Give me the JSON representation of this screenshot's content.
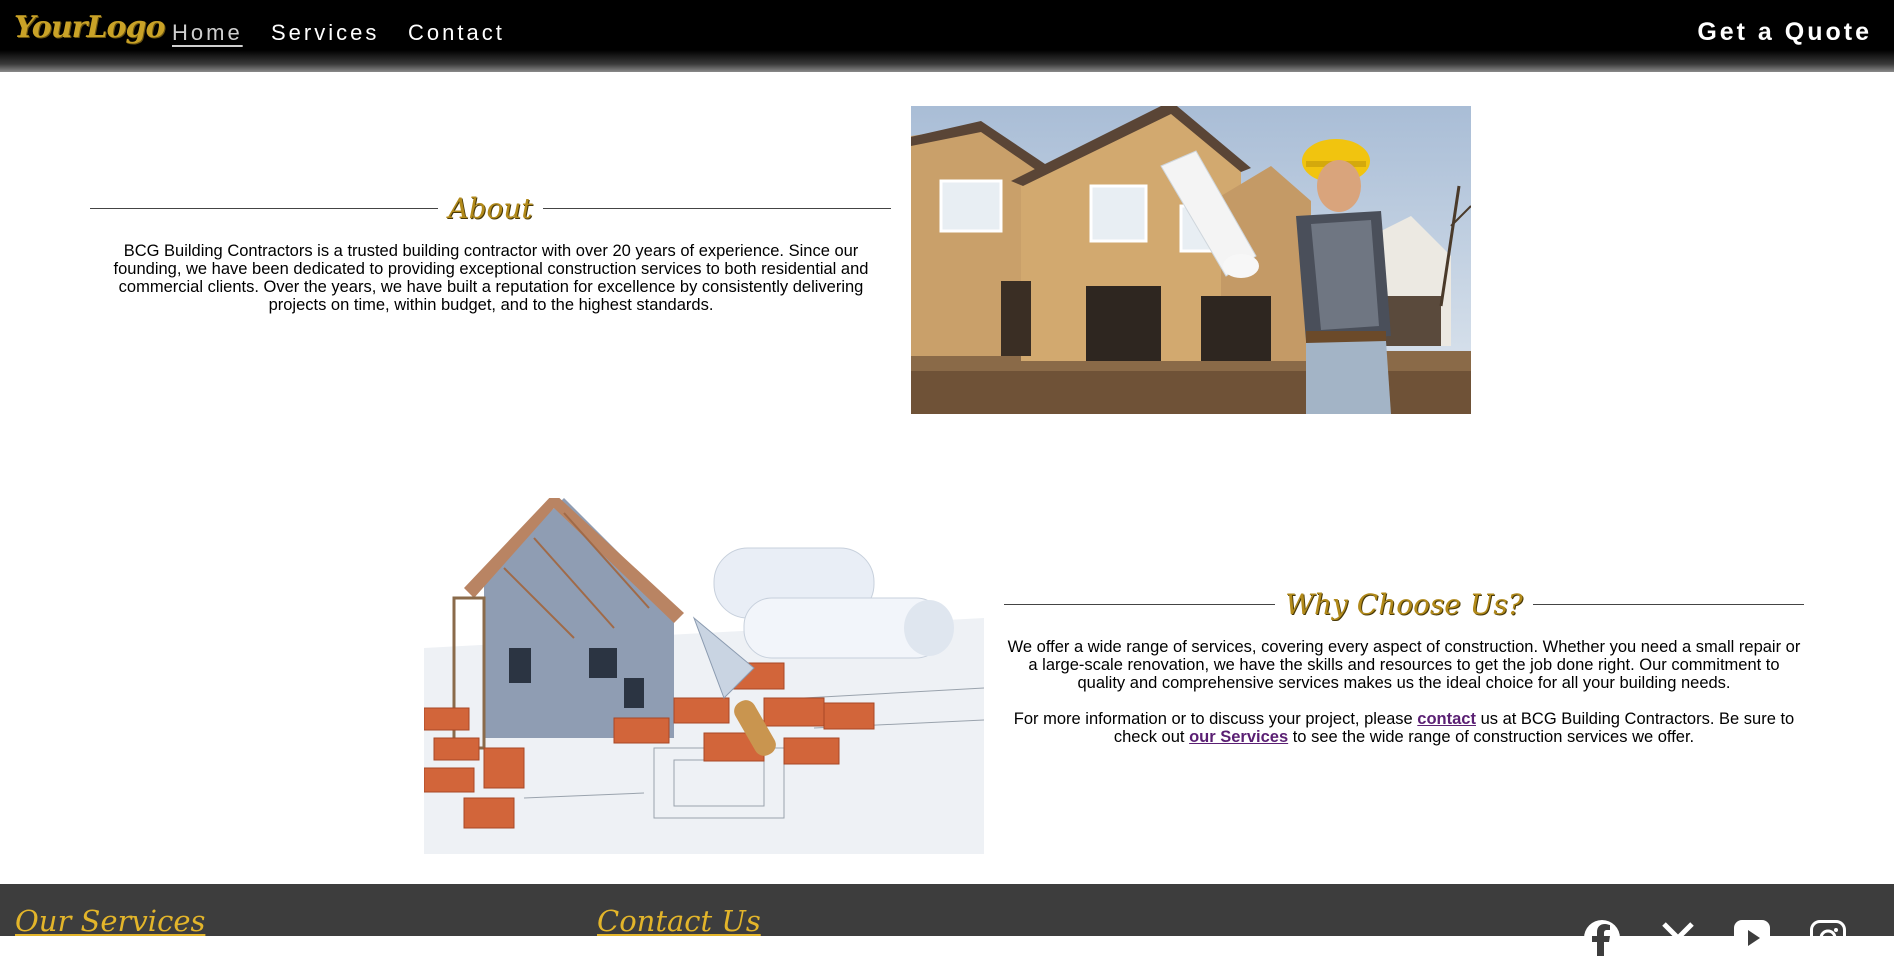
{
  "nav": {
    "logo": "YourLogo",
    "links": [
      "Home",
      "Services",
      "Contact"
    ],
    "quote": "Get a Quote"
  },
  "about": {
    "title": "About",
    "text": "BCG Building Contractors is a trusted building contractor with over 20 years of experience. Since our founding, we have been dedicated to providing exceptional construction services to both residential and commercial clients. Over the years, we have built a reputation for excellence by consistently delivering projects on time, within budget, and to the highest standards."
  },
  "why": {
    "title": "Why Choose Us?",
    "text1": "We offer a wide range of services, covering every aspect of construction. Whether you need a small repair or a large-scale renovation, we have the skills and resources to get the job done right. Our commitment to quality and comprehensive services makes us the ideal choice for all your building needs.",
    "text2_a": "For more information or to discuss your project, please ",
    "text2_link1": "contact",
    "text2_b": " us at BCG Building Contractors. Be sure to check out ",
    "text2_link2": "our Services",
    "text2_c": " to see the wide range of construction services we offer."
  },
  "footer": {
    "services_title": "Our Services",
    "contact_title": "Contact Us",
    "social": [
      "facebook-icon",
      "x-icon",
      "youtube-icon",
      "instagram-icon"
    ]
  },
  "colors": {
    "nav_bg": "#000000",
    "gold": "#c9a227",
    "footer_bg": "#3d3d3d",
    "link": "#5a1f73"
  }
}
